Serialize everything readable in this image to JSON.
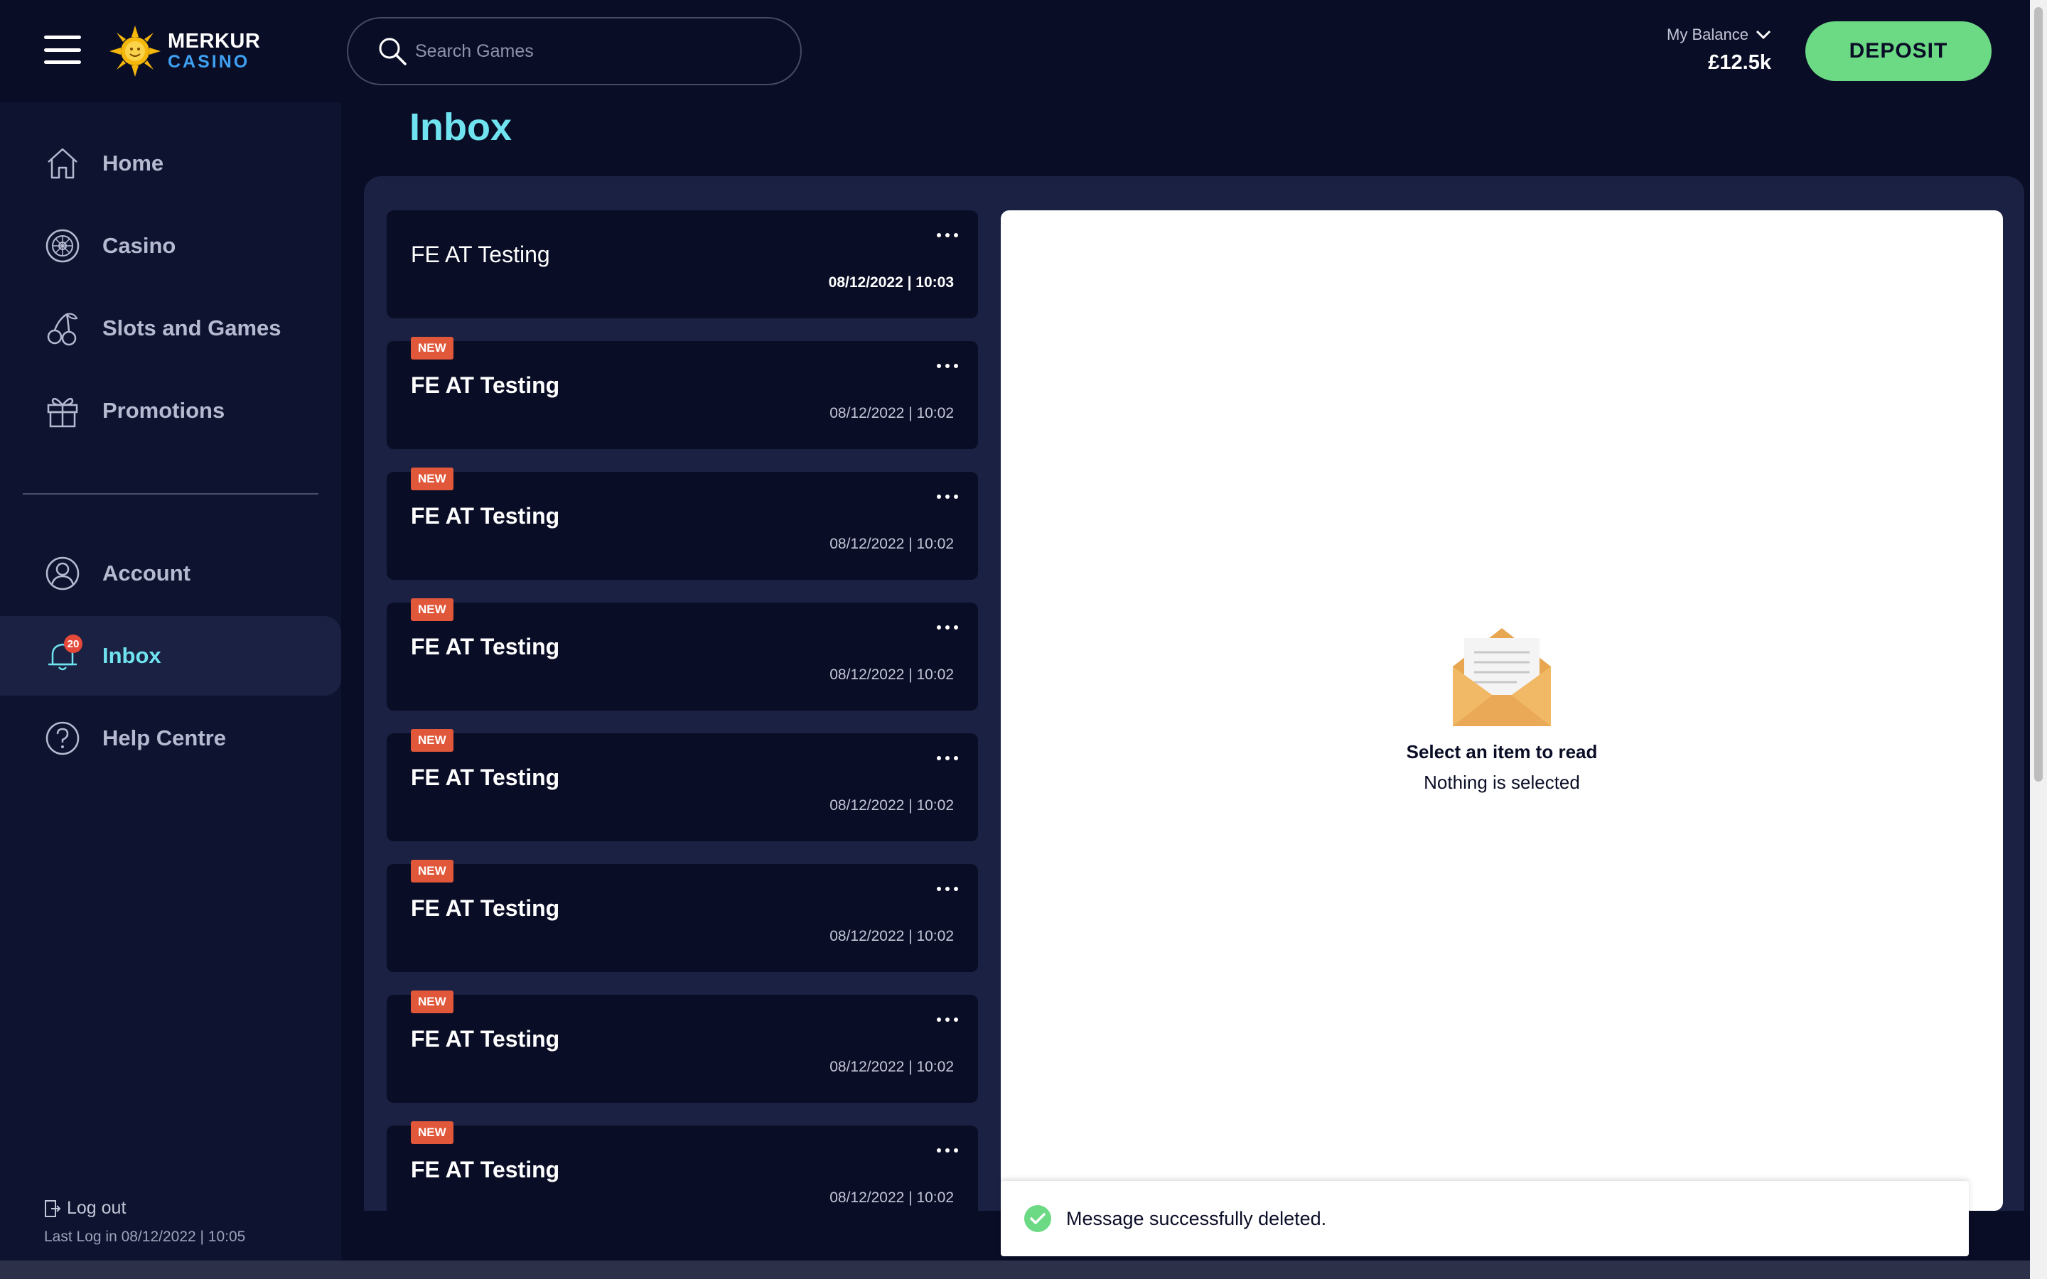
{
  "header": {
    "logo": {
      "line1": "MERKUR",
      "line2": "CASINO"
    },
    "search": {
      "placeholder": "Search Games"
    },
    "balance": {
      "label": "My Balance",
      "value": "£12.5k"
    },
    "deposit_label": "DEPOSIT"
  },
  "sidebar": {
    "items": [
      {
        "label": "Home",
        "icon": "home-icon"
      },
      {
        "label": "Casino",
        "icon": "roulette-icon"
      },
      {
        "label": "Slots and Games",
        "icon": "cherries-icon"
      },
      {
        "label": "Promotions",
        "icon": "gift-icon"
      },
      {
        "label": "Account",
        "icon": "user-icon"
      },
      {
        "label": "Inbox",
        "icon": "bell-icon",
        "badge": "20",
        "active": true
      },
      {
        "label": "Help Centre",
        "icon": "help-icon"
      }
    ],
    "logout_label": "Log out",
    "last_login": "Last Log in 08/12/2022 | 10:05"
  },
  "main": {
    "title": "Inbox",
    "messages": [
      {
        "title": "FE AT Testing",
        "date": "08/12/2022 | 10:03",
        "new": false
      },
      {
        "title": "FE AT Testing",
        "date": "08/12/2022 | 10:02",
        "new": true,
        "badge": "NEW"
      },
      {
        "title": "FE AT Testing",
        "date": "08/12/2022 | 10:02",
        "new": true,
        "badge": "NEW"
      },
      {
        "title": "FE AT Testing",
        "date": "08/12/2022 | 10:02",
        "new": true,
        "badge": "NEW"
      },
      {
        "title": "FE AT Testing",
        "date": "08/12/2022 | 10:02",
        "new": true,
        "badge": "NEW"
      },
      {
        "title": "FE AT Testing",
        "date": "08/12/2022 | 10:02",
        "new": true,
        "badge": "NEW"
      },
      {
        "title": "FE AT Testing",
        "date": "08/12/2022 | 10:02",
        "new": true,
        "badge": "NEW"
      },
      {
        "title": "FE AT Testing",
        "date": "08/12/2022 | 10:02",
        "new": true,
        "badge": "NEW"
      }
    ],
    "reader": {
      "empty_title": "Select an item to read",
      "empty_subtitle": "Nothing is selected"
    },
    "toast": {
      "text": "Message successfully deleted.",
      "icon": "check-circle-icon"
    }
  },
  "colors": {
    "background": "#0a0d26",
    "sidebar": "#0e1330",
    "panel": "#1b2142",
    "accent": "#6fe3ef",
    "deposit": "#6cd984",
    "new_badge": "#e0573a",
    "inbox_badge": "#e5493a"
  }
}
